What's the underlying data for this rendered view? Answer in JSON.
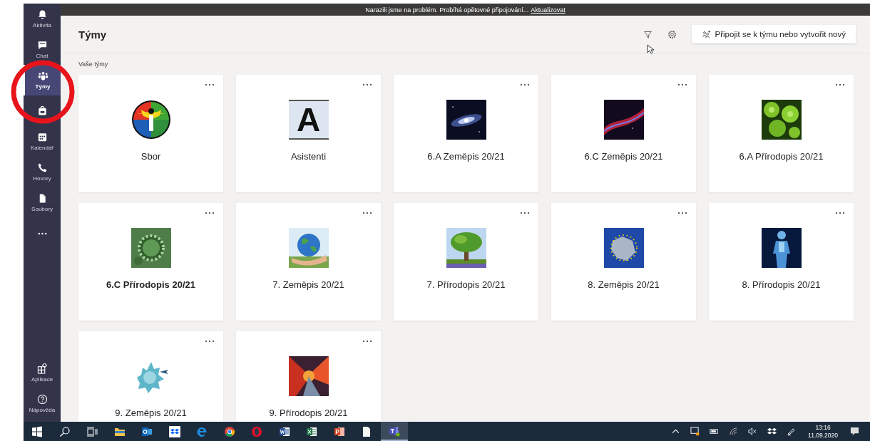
{
  "banner": {
    "message": "Narazili jsme na problém. Probíhá opětovné připojování...",
    "link": "Aktualizovat"
  },
  "rail": {
    "top": [
      {
        "kind": "bell",
        "label": "Aktivita",
        "selected": false
      },
      {
        "kind": "chat",
        "label": "Chat",
        "selected": false
      },
      {
        "kind": "teams",
        "label": "Týmy",
        "selected": true
      },
      {
        "kind": "bag",
        "selected": false
      },
      {
        "kind": "calendar",
        "label": "Kalendář",
        "selected": false
      },
      {
        "kind": "phone",
        "label": "Hovory",
        "selected": false
      },
      {
        "kind": "file",
        "label": "Soubory",
        "selected": false
      },
      {
        "kind": "more",
        "selected": false
      }
    ],
    "bottom": [
      {
        "kind": "apps",
        "label": "Aplikace",
        "selected": false
      },
      {
        "kind": "help",
        "label": "Nápověda",
        "selected": false
      }
    ]
  },
  "header": {
    "title": "Týmy",
    "join_button": "Připojit se k týmu nebo vytvořit nový"
  },
  "section_label": "Vaše týmy",
  "teams": [
    {
      "name": "Sbor",
      "kind": "logo",
      "unread": false
    },
    {
      "name": "Asistenti",
      "kind": "letter",
      "letter": "A",
      "unread": false
    },
    {
      "name": "6.A Zeměpis 20/21",
      "kind": "picture",
      "unread": false
    },
    {
      "name": "6.C Zeměpis 20/21",
      "kind": "picture",
      "unread": false
    },
    {
      "name": "6.A Přírodopis 20/21",
      "kind": "picture",
      "unread": false
    },
    {
      "name": "6.C Přírodopis 20/21",
      "kind": "picture",
      "unread": true
    },
    {
      "name": "7. Zeměpis 20/21",
      "kind": "picture",
      "unread": false
    },
    {
      "name": "7. Přírodopis 20/21",
      "kind": "picture",
      "unread": false
    },
    {
      "name": "8. Zeměpis 20/21",
      "kind": "picture",
      "unread": false
    },
    {
      "name": "8. Přírodopis 20/21",
      "kind": "picture",
      "unread": false
    },
    {
      "name": "9. Zeměpis 20/21",
      "kind": "picture",
      "unread": false
    },
    {
      "name": "9. Přírodopis 20/21",
      "kind": "picture",
      "unread": false
    }
  ],
  "taskbar": {
    "apps": [
      {
        "kind": "start",
        "selected": false
      },
      {
        "kind": "search",
        "selected": false
      },
      {
        "kind": "taskview",
        "selected": false
      },
      {
        "kind": "explorer",
        "selected": false
      },
      {
        "kind": "outlook",
        "selected": false
      },
      {
        "kind": "dropbox",
        "selected": false
      },
      {
        "kind": "edge",
        "selected": false
      },
      {
        "kind": "chrome",
        "selected": false
      },
      {
        "kind": "opera",
        "selected": false
      },
      {
        "kind": "word",
        "selected": false
      },
      {
        "kind": "excel",
        "selected": false
      },
      {
        "kind": "powerpoint",
        "selected": false
      },
      {
        "kind": "document",
        "selected": false
      },
      {
        "kind": "teams",
        "selected": true
      }
    ],
    "tray": [
      {
        "kind": "chevron"
      },
      {
        "kind": "monitor"
      },
      {
        "kind": "battery"
      },
      {
        "kind": "wifi"
      },
      {
        "kind": "muted"
      },
      {
        "kind": "dropbox"
      },
      {
        "kind": "pen"
      }
    ],
    "time": "13:16",
    "date": "11.09.2020"
  }
}
